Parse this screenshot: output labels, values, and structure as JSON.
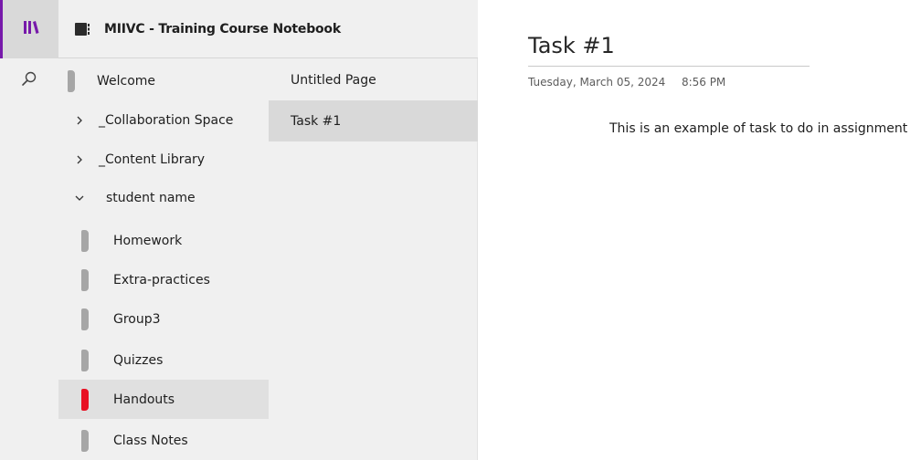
{
  "colors": {
    "accent": "#7719aa",
    "active_section": "#e81123",
    "section_tab": "#a6a6a6"
  },
  "rail": {
    "notebooks_icon": "notebooks-library-icon",
    "search_icon": "search-icon"
  },
  "notebook": {
    "icon": "notebook-icon",
    "title": "MIIVC - Training Course Notebook"
  },
  "sections": [
    {
      "label": "Welcome",
      "kind": "section"
    },
    {
      "label": "_Collaboration Space",
      "kind": "group",
      "expanded": false
    },
    {
      "label": "_Content Library",
      "kind": "group",
      "expanded": false
    },
    {
      "label": "student name",
      "kind": "group",
      "expanded": true
    },
    {
      "label": "Homework",
      "kind": "section"
    },
    {
      "label": "Extra-practices",
      "kind": "section"
    },
    {
      "label": "Group3",
      "kind": "section"
    },
    {
      "label": "Quizzes",
      "kind": "section"
    },
    {
      "label": "Handouts",
      "kind": "section",
      "selected": true
    },
    {
      "label": "Class Notes",
      "kind": "section"
    }
  ],
  "pages": [
    {
      "label": "Untitled Page"
    },
    {
      "label": "Task #1",
      "selected": true
    }
  ],
  "page": {
    "title": "Task #1",
    "date": "Tuesday, March 05, 2024",
    "time": "8:56 PM",
    "body": "This is an example of task to do in assignment"
  }
}
